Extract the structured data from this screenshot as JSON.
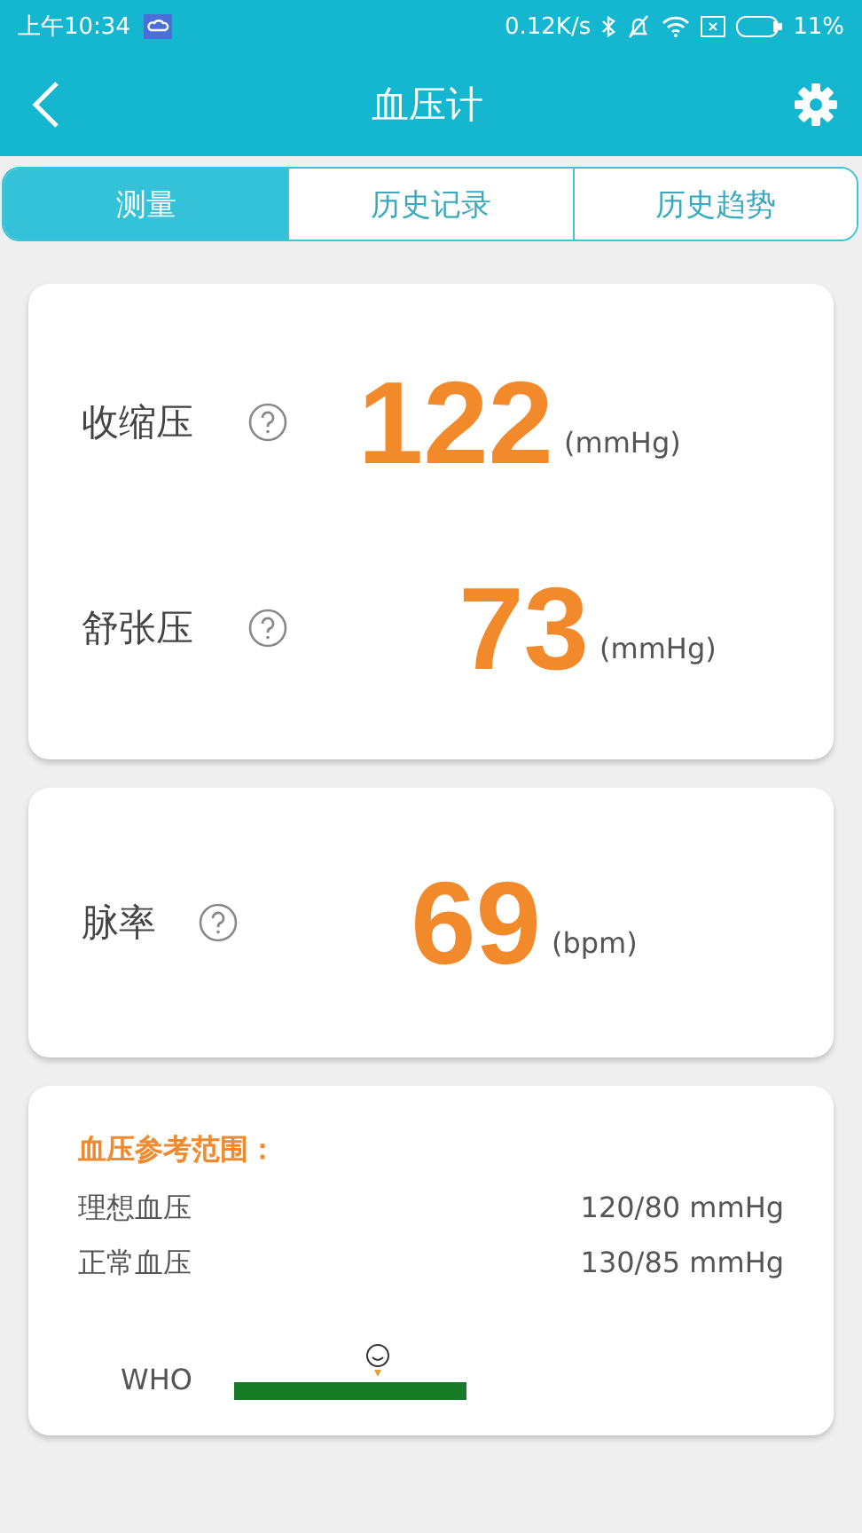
{
  "status_bar": {
    "time": "上午10:34",
    "speed": "0.12K/s",
    "battery": "11%"
  },
  "header": {
    "title": "血压计"
  },
  "tabs": [
    {
      "label": "测量",
      "selected": true
    },
    {
      "label": "历史记录",
      "selected": false
    },
    {
      "label": "历史趋势",
      "selected": false
    }
  ],
  "readings": [
    {
      "label": "收缩压",
      "value": "122",
      "unit": "(mmHg)"
    },
    {
      "label": "舒张压",
      "value": "73",
      "unit": "(mmHg)"
    }
  ],
  "pulse": {
    "label": "脉率",
    "value": "69",
    "unit": "(bpm)"
  },
  "reference": {
    "title": "血压参考范围：",
    "rows": [
      {
        "label": "理想血压",
        "value": "120/80 mmHg"
      },
      {
        "label": "正常血压",
        "value": "130/85 mmHg"
      }
    ],
    "scale_label": "WHO"
  }
}
